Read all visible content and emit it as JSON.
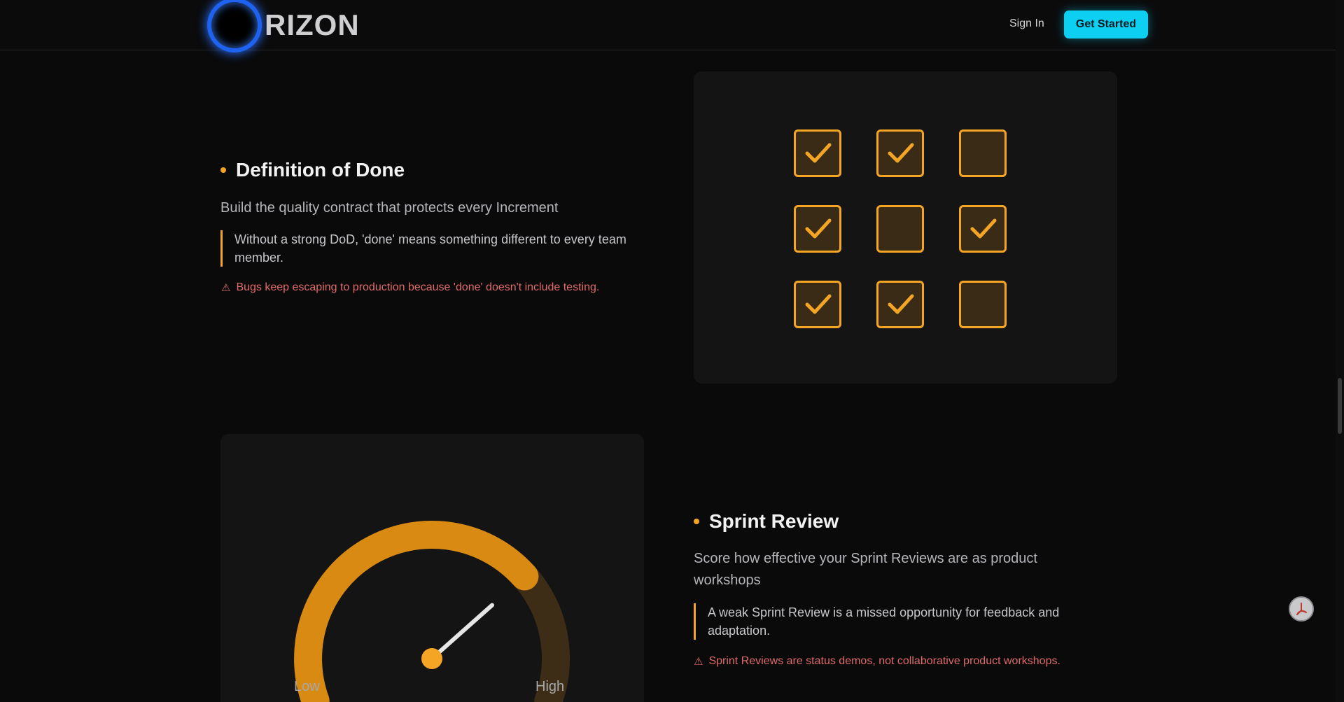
{
  "header": {
    "brand": "RIZON",
    "sign_in": "Sign In",
    "get_started": "Get Started"
  },
  "sections": [
    {
      "title": "Definition of Done",
      "subtitle": "Build the quality contract that protects every Increment",
      "quote": "Without a strong DoD, 'done' means something different to every team member.",
      "warning": "Bugs keep escaping to production because 'done' doesn't include testing.",
      "checklist": [
        true,
        true,
        false,
        true,
        false,
        true,
        true,
        true,
        false
      ]
    },
    {
      "title": "Sprint Review",
      "subtitle": "Score how effective your Sprint Reviews are as product workshops",
      "quote": "A weak Sprint Review is a missed opportunity for feedback and adaptation.",
      "warning": "Sprint Reviews are status demos, not collaborative product workshops.",
      "gauge": {
        "low_label": "Low",
        "high_label": "High",
        "level": 0.72
      }
    }
  ],
  "colors": {
    "accent": "#f5a524",
    "cta": "#0ccff2",
    "warning": "#e06a6a"
  },
  "icons": [
    "logo-ring-icon",
    "warning-icon",
    "checkmark-icon",
    "pdf-icon"
  ]
}
